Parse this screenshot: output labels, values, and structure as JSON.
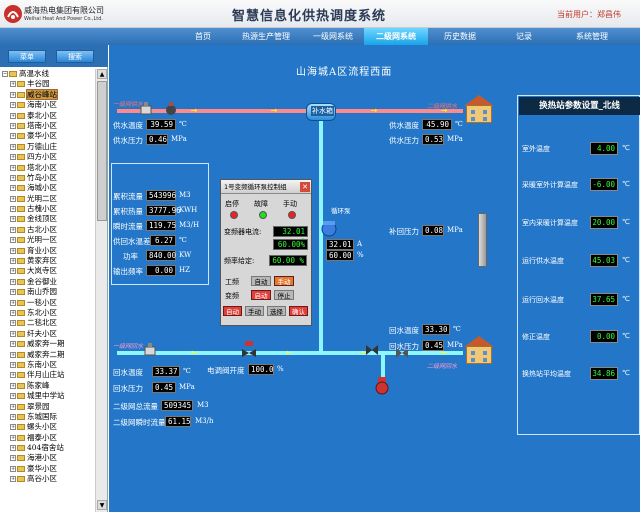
{
  "header": {
    "company_cn": "威海热电集团有限公司",
    "company_en": "Weihai Heat And Power Co.,Ltd.",
    "title": "智慧信息化供热调度系统",
    "current_user": "当前用户：郑昌伟"
  },
  "nav": {
    "items": [
      "首页",
      "热源生产管理",
      "一级网系统",
      "二级网系统",
      "历史数据",
      "记录",
      "系统管理"
    ],
    "active_index": 3
  },
  "sidebar": {
    "menu_button": "菜单",
    "search_button": "搜索",
    "tree": [
      {
        "label": "高温水线",
        "root": true
      },
      {
        "label": "丰谷园"
      },
      {
        "label": "威谷峰站",
        "selected": true
      },
      {
        "label": "海南小区"
      },
      {
        "label": "泰北小区"
      },
      {
        "label": "塔南小区"
      },
      {
        "label": "豪华小区"
      },
      {
        "label": "万德山庄"
      },
      {
        "label": "四方小区"
      },
      {
        "label": "塔北小区"
      },
      {
        "label": "竹岛小区"
      },
      {
        "label": "海城小区"
      },
      {
        "label": "光明二区"
      },
      {
        "label": "古槐小区"
      },
      {
        "label": "金线顶区"
      },
      {
        "label": "古北小区"
      },
      {
        "label": "光明一区"
      },
      {
        "label": "育业小区"
      },
      {
        "label": "黄家弃区"
      },
      {
        "label": "大岚寺区"
      },
      {
        "label": "金谷御业"
      },
      {
        "label": "南山乔园"
      },
      {
        "label": "一毯小区"
      },
      {
        "label": "东北小区"
      },
      {
        "label": "二毯北区"
      },
      {
        "label": "纤夫小区"
      },
      {
        "label": "威家奔一期"
      },
      {
        "label": "威家奔二期"
      },
      {
        "label": "东南小区"
      },
      {
        "label": "伴月山庄站"
      },
      {
        "label": "陈家峰"
      },
      {
        "label": "城里中学站"
      },
      {
        "label": "翠景园"
      },
      {
        "label": "东城国际"
      },
      {
        "label": "螺头小区"
      },
      {
        "label": "福泰小区"
      },
      {
        "label": "404宿舍站"
      },
      {
        "label": "海港小区"
      },
      {
        "label": "豪华小区"
      },
      {
        "label": "高谷小区"
      }
    ]
  },
  "main": {
    "area_title": "山海城A区流程西面",
    "tank_label": "补水箱",
    "pump_label": "循环泵",
    "cabinet_label": "配电柜",
    "tag_primary_supply": "一级网供水",
    "tag_primary_return": "一级网回水",
    "tag_secondary_supply": "二级网供水",
    "tag_secondary_return": "二级网回水",
    "supply_left": {
      "temp_label": "供水温度",
      "temp": "39.59",
      "temp_unit": "℃",
      "pres_label": "供水压力",
      "pres": "0.46",
      "pres_unit": "MPa"
    },
    "supply_right": {
      "temp_label": "供水温度",
      "temp": "45.90",
      "temp_unit": "℃",
      "pres_label": "供水压力",
      "pres": "0.53",
      "pres_unit": "MPa"
    },
    "flow": {
      "cum_flow_label": "累积流量",
      "cum_flow": "543996",
      "cum_flow_unit": "M3",
      "cum_heat_label": "累积热量",
      "cum_heat": "3777.96",
      "cum_heat_unit": "KWH",
      "inst_flow_label": "瞬时流量",
      "inst_flow": "119.75",
      "inst_flow_unit": "M3/H",
      "prim_ret_label": "供回水温差",
      "prim_ret": "6.27",
      "prim_ret_unit": "℃",
      "power_label": "功率",
      "power": "840.00",
      "power_unit": "KW",
      "freq_label": "输出频率",
      "freq": "0.00",
      "freq_unit": "HZ"
    },
    "pump_readout": {
      "current": "32.01",
      "current_unit": "A",
      "freq": "60.00",
      "freq_unit": "%"
    },
    "make_up_pres": {
      "label": "补回压力",
      "value": "0.08",
      "unit": "MPa"
    },
    "return_right": {
      "temp_label": "回水温度",
      "temp": "33.30",
      "temp_unit": "℃",
      "pres_label": "回水压力",
      "pres": "0.45",
      "pres_unit": "MPa"
    },
    "return_left": {
      "temp_label": "回水温度",
      "temp": "33.37",
      "temp_unit": "℃",
      "pres_label": "回水压力",
      "pres": "0.45",
      "pres_unit": "MPa"
    },
    "valve": {
      "label": "电调阀开度",
      "value": "100.0",
      "unit": "%"
    },
    "sec_total": {
      "label": "二级网总流量",
      "value": "509345",
      "unit": "M3"
    },
    "sec_inst": {
      "label": "二级网瞬时流量",
      "value": "61.15",
      "unit": "M3/h"
    }
  },
  "dialog": {
    "title": "1号变频循环泵控制组",
    "close": "✕",
    "start_stop": "启停",
    "fault": "故障",
    "manual": "手动",
    "vfd_current_label": "变频器电流:",
    "vfd_current": "32.01 A",
    "vfd_percent": "60.00%",
    "freq_set_label": "频率给定:",
    "freq_set": "60.00 %",
    "power_freq_label": "工频",
    "var_freq_label": "变频",
    "btn_auto_1": "自动",
    "btn_manual_1": "手动",
    "btn_start": "启动",
    "btn_stop": "停止",
    "btn_auto_2": "自动",
    "btn_manual_2": "手动",
    "btn_select": "选择",
    "btn_confirm": "确认"
  },
  "params": {
    "title": "换热站参数设置_北线",
    "rows": [
      {
        "label": "室外温度",
        "value": "4.00",
        "unit": "℃"
      },
      {
        "label": "采暖室外计算温度",
        "value": "-6.00",
        "unit": "℃"
      },
      {
        "label": "室内采暖计算温度",
        "value": "20.00",
        "unit": "℃"
      },
      {
        "label": "运行供水温度",
        "value": "45.03",
        "unit": "℃"
      },
      {
        "label": "运行回水温度",
        "value": "37.65",
        "unit": "℃"
      },
      {
        "label": "修正温度",
        "value": "0.00",
        "unit": "℃"
      },
      {
        "label": "换热站平均温度",
        "value": "34.86",
        "unit": "℃"
      }
    ]
  },
  "colors": {
    "nav_bg": "#2c6fb3",
    "nav_active": "#1aa3e8",
    "main_bg": "#2477c8",
    "supply_pipe": "#ff8a8a",
    "return_pipe": "#8ef6ff",
    "title_bar": "#0d2a45",
    "led_green": "#22dd22",
    "led_red": "#ee2222",
    "led_gray": "#9a9a9a"
  }
}
